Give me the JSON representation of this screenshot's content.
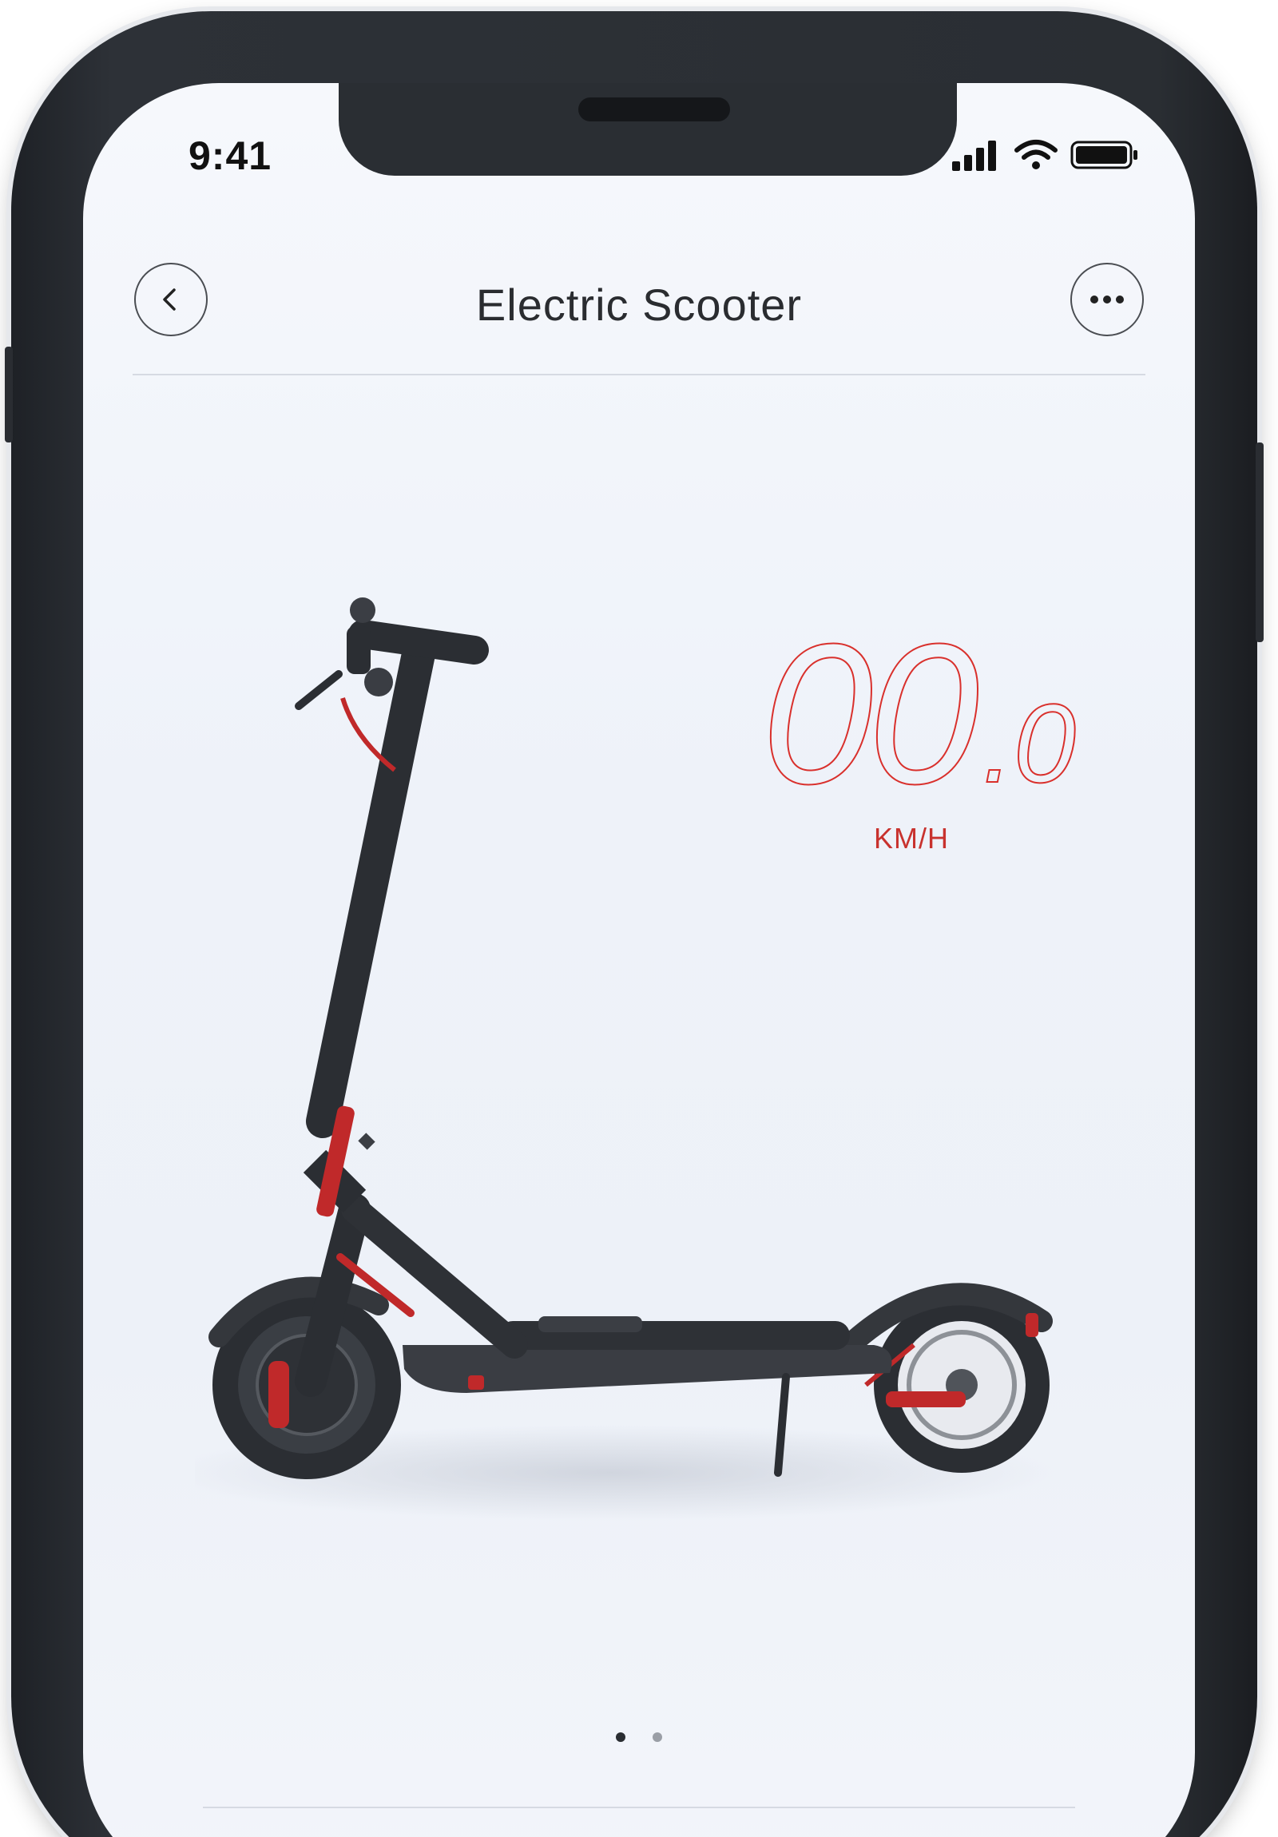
{
  "status_bar": {
    "time": "9:41",
    "icons": [
      "signal-icon",
      "wifi-icon",
      "battery-icon"
    ]
  },
  "nav": {
    "title": "Electric Scooter",
    "back_icon": "chevron-left-icon",
    "more_icon": "more-dots-icon"
  },
  "speedometer": {
    "value_main": "00",
    "value_decimal": ".0",
    "unit": "KM/H",
    "color": "#d9302c"
  },
  "pager": {
    "count": 2,
    "active_index": 0
  },
  "colors": {
    "accent": "#d9302c",
    "frame": "#2a2e33",
    "screen_bg": "#eef2f9"
  }
}
